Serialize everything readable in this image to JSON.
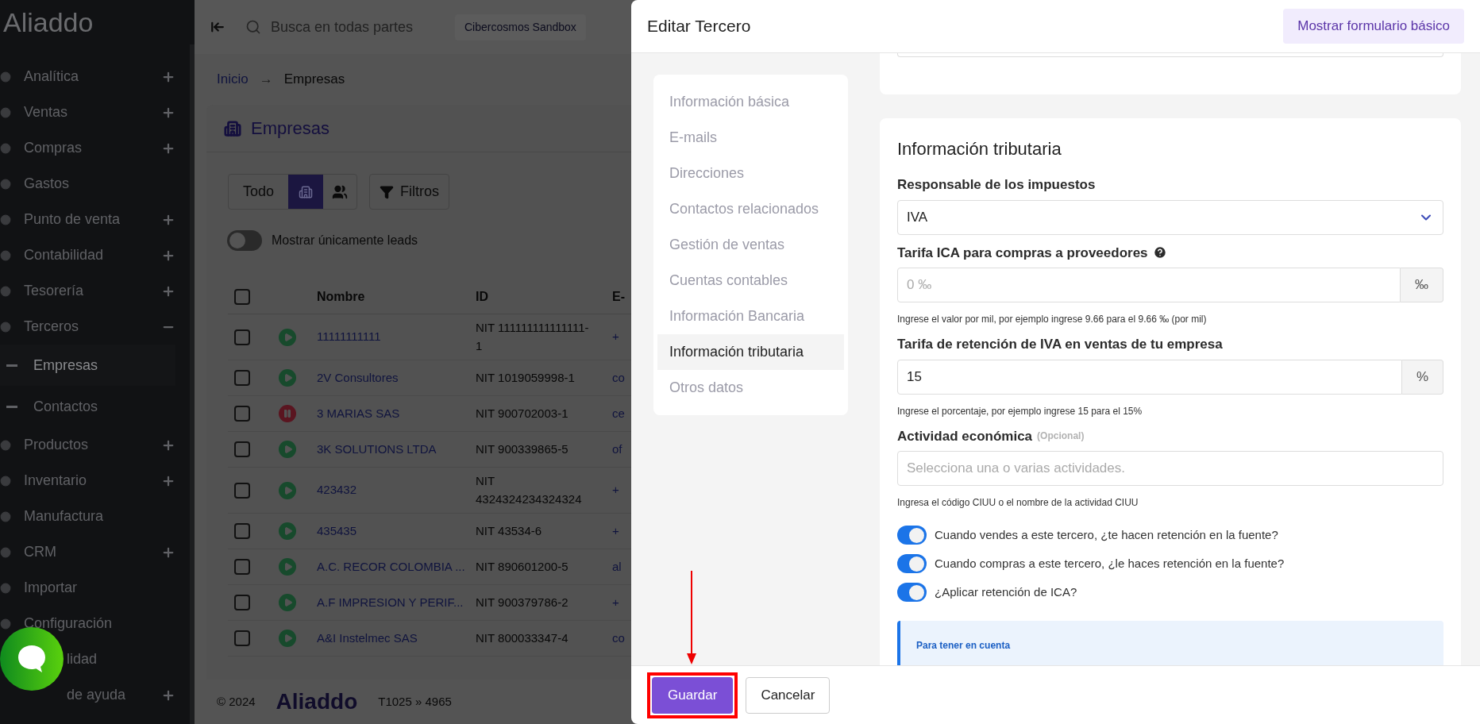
{
  "sidebar": {
    "logo": "Aliaddo",
    "items": [
      {
        "label": "Analítica",
        "kind": "expandable",
        "expanded": false
      },
      {
        "label": "Ventas",
        "kind": "expandable",
        "expanded": false
      },
      {
        "label": "Compras",
        "kind": "expandable",
        "expanded": false
      },
      {
        "label": "Gastos",
        "kind": "plain"
      },
      {
        "label": "Punto de venta",
        "kind": "expandable",
        "expanded": false
      },
      {
        "label": "Contabilidad",
        "kind": "expandable",
        "expanded": false
      },
      {
        "label": "Tesorería",
        "kind": "expandable",
        "expanded": false
      },
      {
        "label": "Terceros",
        "kind": "expandable",
        "expanded": true,
        "children": [
          {
            "label": "Empresas",
            "selected": true
          },
          {
            "label": "Contactos",
            "selected": false
          }
        ]
      },
      {
        "label": "Productos",
        "kind": "expandable",
        "expanded": false
      },
      {
        "label": "Inventario",
        "kind": "expandable",
        "expanded": false
      },
      {
        "label": "Manufactura",
        "kind": "plain"
      },
      {
        "label": "CRM",
        "kind": "expandable",
        "expanded": false
      },
      {
        "label": "Importar",
        "kind": "plain"
      },
      {
        "label": "Configuración",
        "kind": "plain"
      },
      {
        "label": "lidad",
        "kind": "covered"
      },
      {
        "label": "de ayuda",
        "kind": "covered-expandable",
        "expanded": false
      }
    ]
  },
  "topbar": {
    "search_placeholder": "Busca en todas partes",
    "company": "Cibercosmos Sandbox"
  },
  "breadcrumb": {
    "items": [
      "Inicio",
      "Empresas"
    ],
    "separator": "→"
  },
  "page": {
    "title": "Empresas",
    "filters": [
      {
        "kind": "text",
        "label": "Todo",
        "selected": false
      },
      {
        "kind": "building",
        "selected": true
      },
      {
        "kind": "people",
        "selected": false
      }
    ],
    "filters_button": "Filtros",
    "leads_toggle": {
      "label": "Mostrar únicamente leads",
      "on": false
    }
  },
  "table": {
    "all_checked": false,
    "columns": [
      "Nombre",
      "ID",
      "E-"
    ],
    "rows": [
      {
        "checked": false,
        "paused": false,
        "name": "11111111111",
        "id": "NIT 111111111111111-1",
        "email": "+"
      },
      {
        "checked": false,
        "paused": false,
        "name": "2V Consultores",
        "id": "NIT 1019059998-1",
        "email": "co"
      },
      {
        "checked": false,
        "paused": true,
        "name": "3 MARIAS SAS",
        "id": "NIT 900702003-1",
        "email": "ce"
      },
      {
        "checked": false,
        "paused": false,
        "name": "3K SOLUTIONS LTDA",
        "id": "NIT 900339865-5",
        "email": "of"
      },
      {
        "checked": false,
        "paused": false,
        "name": "423432",
        "id": "NIT 4324324234324324",
        "email": "+"
      },
      {
        "checked": false,
        "paused": false,
        "name": "435435",
        "id": "NIT 43534-6",
        "email": "+"
      },
      {
        "checked": false,
        "paused": false,
        "name": "A.C. RECOR COLOMBIA ...",
        "id": "NIT 890601200-5",
        "email": "al"
      },
      {
        "checked": false,
        "paused": false,
        "name": "A.F IMPRESION Y PERIF...",
        "id": "NIT 900379786-2",
        "email": "+"
      },
      {
        "checked": false,
        "paused": false,
        "name": "A&I Instelmec SAS",
        "id": "NIT 800033347-4",
        "email": "co"
      }
    ]
  },
  "footer": {
    "copyright": "© 2024",
    "logo": "Aliaddo",
    "version": "T1025 » 4965"
  },
  "drawer": {
    "title": "Editar Tercero",
    "basic_form_button": "Mostrar formulario básico",
    "nav": [
      {
        "label": "Información básica",
        "selected": false
      },
      {
        "label": "E-mails",
        "selected": false
      },
      {
        "label": "Direcciones",
        "selected": false
      },
      {
        "label": "Contactos relacionados",
        "selected": false
      },
      {
        "label": "Gestión de ventas",
        "selected": false
      },
      {
        "label": "Cuentas contables",
        "selected": false
      },
      {
        "label": "Información Bancaria",
        "selected": false
      },
      {
        "label": "Información tributaria",
        "selected": true
      },
      {
        "label": "Otros datos",
        "selected": false
      }
    ],
    "section_title": "Información tributaria",
    "fields": [
      {
        "kind": "select",
        "label": "Responsable de los impuestos",
        "value": "IVA"
      },
      {
        "kind": "addon",
        "label": "Tarifa ICA para compras a proveedores",
        "help": true,
        "placeholder": "0 ‰",
        "addon": "‰",
        "hint": "Ingrese el valor por mil, por ejemplo ingrese 9.66 para el 9.66 ‰ (por mil)"
      },
      {
        "kind": "addon",
        "label": "Tarifa de retención de IVA en ventas de tu empresa",
        "value": "15",
        "addon": "%",
        "hint": "Ingrese el porcentaje, por ejemplo ingrese 15 para el 15%"
      },
      {
        "kind": "text",
        "label": "Actividad económica",
        "optional": "(Opcional)",
        "placeholder": "Selecciona una o varias actividades.",
        "hint": "Ingresa el código CIUU o el nombre de la actividad CIUU"
      }
    ],
    "switches": [
      {
        "label": "Cuando vendes a este tercero, ¿te hacen retención en la fuente?",
        "on": true
      },
      {
        "label": "Cuando compras a este tercero, ¿le haces retención en la fuente?",
        "on": true
      },
      {
        "label": "¿Aplicar retención de ICA?",
        "on": true
      }
    ],
    "notice_title": "Para tener en cuenta",
    "save_button": "Guardar",
    "cancel_button": "Cancelar"
  }
}
